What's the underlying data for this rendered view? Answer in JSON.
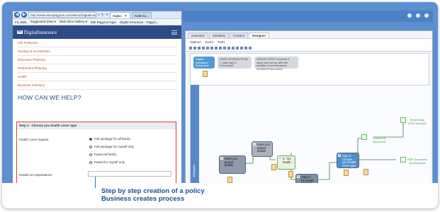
{
  "browser": {
    "url": "http://www.ebonpagyrus.com/demo/DigitalInsurance/",
    "tabs": [
      {
        "label": "Digita... ✕",
        "active": true
      },
      {
        "label": "ACM Co...",
        "active": false
      }
    ],
    "favorites": [
      "Fit_Web",
      "Suggested Sites ▾",
      "Web Slice Gallery ▾",
      "EBI Pagyrus login",
      "Digital Insurance - Pagyru..."
    ]
  },
  "site": {
    "logo_mark": "DI",
    "logo_text": "DigitalInsurance",
    "menu_items": [
      "Life Protection",
      "Savings & Investments",
      "Education Planning",
      "Retirement Planning",
      "Health",
      "Business Solutions"
    ],
    "help_title": "HOW CAN WE HELP?",
    "form": {
      "step_title": "Step 3 - Choose you health cover type",
      "cover_label": "Health cover request",
      "options": [
        {
          "label": "Full package for all family",
          "selected": true
        },
        {
          "label": "Full package for myself only",
          "selected": false
        },
        {
          "label": "Partial all family",
          "selected": false
        },
        {
          "label": "Partial for myself only",
          "selected": false
        }
      ],
      "expectations_label": "Details on expectations"
    }
  },
  "designer": {
    "tabs": [
      "Overview",
      "Variables",
      "Content",
      "Designer"
    ],
    "active_tab": "Designer",
    "menu": [
      "Options",
      "Zoom",
      "Tools"
    ],
    "stages": [
      {
        "label": "Digital Insurance Enrolment",
        "color": "#4f9bd6"
      },
      {
        "label": "USER INTERACTION: 1. Add to(s) 2. Processed",
        "color": "#d5d8de"
      },
      {
        "label": "GROUP STEP: Involves 3 steps and set up with the creation of an insurance enrolment document",
        "color": "#d5d8de"
      }
    ],
    "lane_label": "Enterprise",
    "nodes": [
      {
        "num": "2",
        "label": "Enter you person details"
      },
      {
        "num": "3",
        "label": "Enter you adress details"
      },
      {
        "num": "4",
        "label": "2 - No health..."
      },
      {
        "num": "5",
        "label": "Step 2 - No health problem"
      },
      {
        "num": "6",
        "label": "Step 3 - Choose you health cover type"
      }
    ],
    "outputs": [
      "Send Email (PDF-insured)",
      "Format Of Document",
      "PDF Document as document"
    ]
  },
  "caption": {
    "line1": "Step by step creation of a policy",
    "line2": "Business creates process"
  },
  "colors": {
    "frame_blue": "#5b8fd0",
    "site_header": "#2d4c86",
    "menu_link": "#b25628",
    "form_border": "#d8452f",
    "caption": "#1e4f93"
  }
}
